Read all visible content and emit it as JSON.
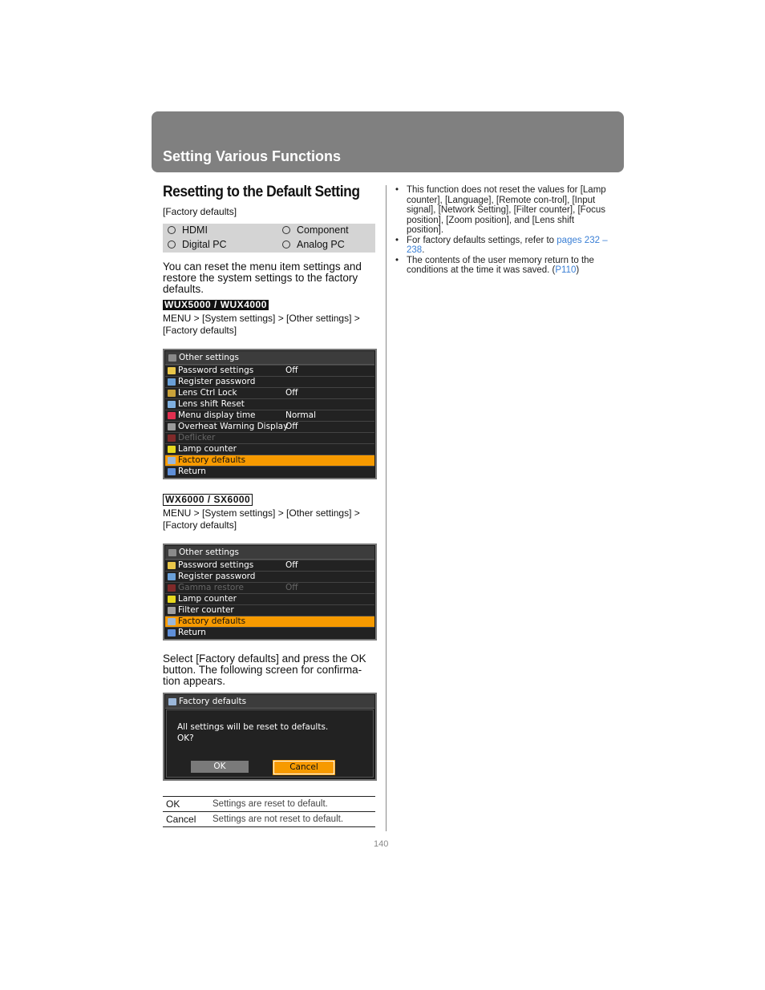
{
  "header": {
    "section_title": "Setting Various Functions"
  },
  "main": {
    "title": "Resetting to the Default Setting",
    "subtitle": "[Factory defaults]",
    "input_sources": [
      "HDMI",
      "Component",
      "Digital PC",
      "Analog PC"
    ],
    "intro": "You can reset the menu item settings and restore the system settings to the factory defaults.",
    "section1": {
      "model": "WUX5000 / WUX4000",
      "path": "MENU > [System settings] > [Other settings] > [Factory defaults]",
      "menu": {
        "title": "Other settings",
        "rows": [
          {
            "label": "Password settings",
            "value": "Off",
            "icon": "key-icon",
            "state": "normal"
          },
          {
            "label": "Register password",
            "value": "",
            "icon": "password-icon",
            "state": "normal"
          },
          {
            "label": "Lens Ctrl Lock",
            "value": "Off",
            "icon": "lens-lock-icon",
            "state": "normal"
          },
          {
            "label": "Lens shift Reset",
            "value": "",
            "icon": "lens-shift-icon",
            "state": "normal"
          },
          {
            "label": "Menu display time",
            "value": "Normal",
            "icon": "timer-icon",
            "state": "normal"
          },
          {
            "label": "Overheat Warning Display",
            "value": "Off",
            "icon": "overheat-icon",
            "state": "normal"
          },
          {
            "label": "Deflicker",
            "value": "",
            "icon": "deflicker-icon",
            "state": "disabled"
          },
          {
            "label": "Lamp counter",
            "value": "",
            "icon": "lamp-icon",
            "state": "normal"
          },
          {
            "label": "Factory defaults",
            "value": "",
            "icon": "factory-icon",
            "state": "selected"
          },
          {
            "label": "Return",
            "value": "",
            "icon": "return-icon",
            "state": "normal"
          }
        ]
      }
    },
    "section2": {
      "model": "WX6000 / SX6000",
      "path": "MENU > [System settings] > [Other settings] > [Factory defaults]",
      "menu": {
        "title": "Other settings",
        "rows": [
          {
            "label": "Password settings",
            "value": "Off",
            "icon": "key-icon",
            "state": "normal"
          },
          {
            "label": "Register password",
            "value": "",
            "icon": "password-icon",
            "state": "normal"
          },
          {
            "label": "Gamma restore",
            "value": "Off",
            "icon": "gamma-icon",
            "state": "disabled"
          },
          {
            "label": "Lamp counter",
            "value": "",
            "icon": "lamp-icon",
            "state": "normal"
          },
          {
            "label": "Filter counter",
            "value": "",
            "icon": "filter-icon",
            "state": "normal"
          },
          {
            "label": "Factory defaults",
            "value": "",
            "icon": "factory-icon",
            "state": "selected"
          },
          {
            "label": "Return",
            "value": "",
            "icon": "return-icon",
            "state": "normal"
          }
        ]
      }
    },
    "instruction": {
      "before": "Select [Factory defaults] and press the ",
      "key": "OK",
      "after": " button. The following screen for confirma-tion appears."
    },
    "dialog": {
      "title": "Factory defaults",
      "message_line1": "All settings will be reset to defaults.",
      "message_line2": "OK?",
      "ok_label": "OK",
      "cancel_label": "Cancel"
    },
    "result_table": [
      {
        "key": "OK",
        "desc": "Settings are reset to default."
      },
      {
        "key": "Cancel",
        "desc": "Settings are not reset to default."
      }
    ]
  },
  "notes": {
    "bullet1": "This function does not reset the values for [Lamp counter], [Language], [Remote con-trol], [Input signal], [Network Setting], [Filter counter], [Focus position], [Zoom position], and [Lens shift position].",
    "bullet2_text": "For factory defaults settings, refer to ",
    "bullet2_link": "pages 232 – 238",
    "bullet2_end": ".",
    "bullet3_text": "The contents of the user memory return to the conditions at the time it was saved. (",
    "bullet3_link": "P110",
    "bullet3_end": ")"
  },
  "page_number": "140",
  "colors": {
    "header_bg": "#808080",
    "highlight": "#f79a00",
    "link": "#3a7fd5"
  }
}
